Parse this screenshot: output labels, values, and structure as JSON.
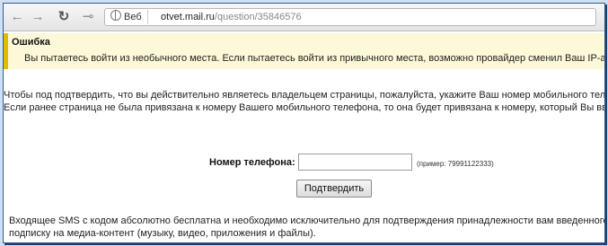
{
  "browser": {
    "back_glyph": "←",
    "forward_glyph": "→",
    "reload_glyph": "↻",
    "key_glyph": "⊸",
    "site_chip_label": "Веб",
    "url_host": "otvet.mail.ru",
    "url_path": "/question/35846576"
  },
  "error": {
    "title": "Ошибка",
    "message": "Вы пытаетесь войти из необычного места. Если пытаетесь войти из привычного места, возможно провайдер сменил Ваш IP-адрес."
  },
  "info": {
    "line1": "Чтобы под подтвердить, что вы действительно являетесь владельцем страницы, пожалуйста, укажите Ваш номер мобильного телефона, к которому привязан",
    "line2": "Если ранее страница не была привязана к номеру Вашего мобильного телефона, то она будет привязана к номеру, который Вы введете ниже:"
  },
  "form": {
    "phone_label": "Номер телефона:",
    "phone_value": "",
    "phone_example": "(пример: 79991122333)",
    "submit_label": "Подтвердить"
  },
  "footer": {
    "line1": "Входящее SMS с кодом абсолютно бесплатна и необходимо исключительно для подтверждения принадлежности вам введенного номера мобильного",
    "line2": "подписку на медиа-контент (музыку, видео, приложения и файлы)."
  },
  "colors": {
    "error_accent": "#e6b800",
    "error_background": "#fdf8d7",
    "frame_border": "#2d5c96"
  }
}
